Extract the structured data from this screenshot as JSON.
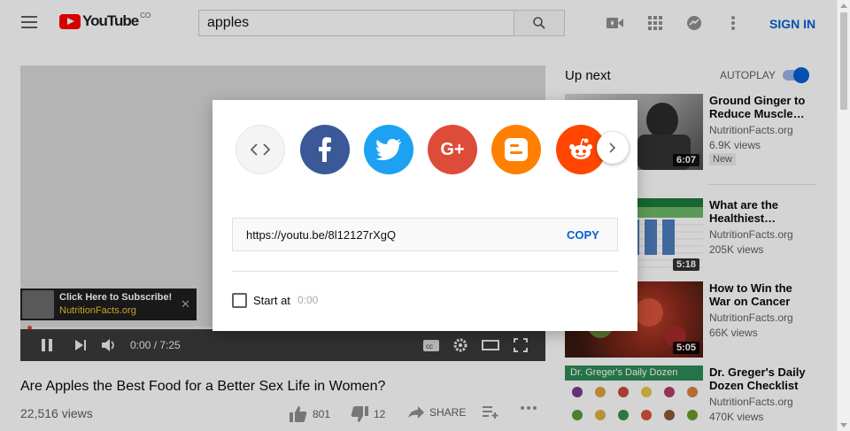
{
  "header": {
    "logo_text": "YouTube",
    "country_code": "CO",
    "search_value": "apples",
    "sign_in_label": "SIGN IN",
    "icons": [
      "menu-icon",
      "search-icon",
      "video-camera-icon",
      "apps-grid-icon",
      "messages-icon",
      "more-vertical-icon"
    ]
  },
  "player": {
    "time": "0:00 / 7:25",
    "progress": 0,
    "subscribe_banner": {
      "line1": "Click Here to Subscribe!",
      "line2": "NutritionFacts.org"
    }
  },
  "video": {
    "title": "Are Apples the Best Food for a Better Sex Life in Women?",
    "views": "22,516 views",
    "likes": "801",
    "dislikes": "12",
    "share_label": "SHARE"
  },
  "sidebar": {
    "up_next_label": "Up next",
    "autoplay_label": "AUTOPLAY",
    "autoplay_on": true,
    "recommendations": [
      {
        "title_line1": "Ground Ginger to",
        "title_line2": "Reduce Muscle…",
        "channel": "NutritionFacts.org",
        "views": "6.9K views",
        "badge": "New",
        "duration": "6:07"
      },
      {
        "title_line1": "What are the",
        "title_line2": "Healthiest…",
        "channel": "NutritionFacts.org",
        "views": "205K views",
        "badge": "",
        "duration": "5:18"
      },
      {
        "title_line1": "How to Win the",
        "title_line2": "War on Cancer",
        "channel": "NutritionFacts.org",
        "views": "66K views",
        "badge": "",
        "duration": "5:05"
      },
      {
        "title_line1": "Dr. Greger's Daily",
        "title_line2": "Dozen Checklist",
        "channel": "NutritionFacts.org",
        "views": "470K views",
        "badge": "",
        "duration": "",
        "thumb_text": "Dr. Greger's Daily Dozen"
      }
    ]
  },
  "share_dialog": {
    "url": "https://youtu.be/8l12127rXgQ",
    "copy_label": "COPY",
    "start_at_label": "Start at",
    "start_time": "0:00",
    "start_checked": false,
    "targets": [
      {
        "name": "embed",
        "glyph": "<>",
        "color": "#f4f4f4"
      },
      {
        "name": "facebook",
        "glyph": "f",
        "color": "#3b5998"
      },
      {
        "name": "twitter",
        "glyph": "",
        "color": "#1da1f2"
      },
      {
        "name": "google-plus",
        "glyph": "G+",
        "color": "#dd4b39"
      },
      {
        "name": "blogger",
        "glyph": "",
        "color": "#ff8000"
      },
      {
        "name": "reddit",
        "glyph": "",
        "color": "#ff4500"
      }
    ]
  }
}
